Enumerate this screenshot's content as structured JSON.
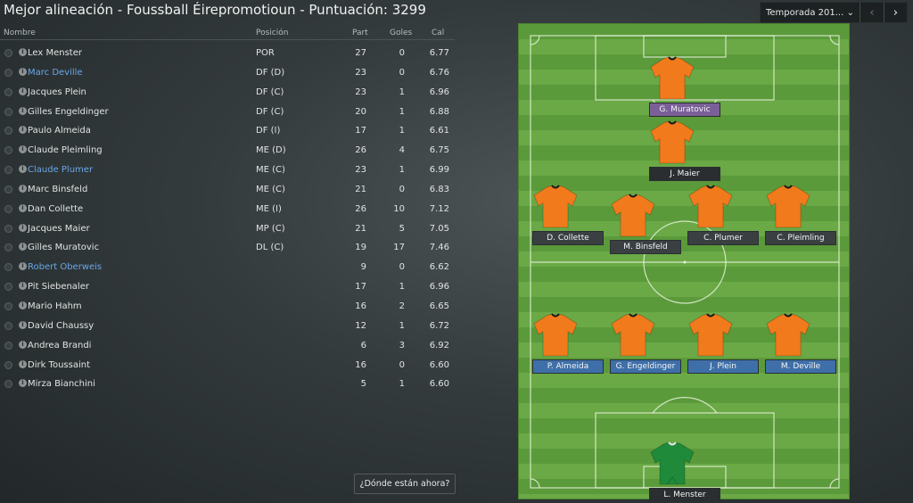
{
  "header": {
    "title": "Mejor alineación - Foussball Éirepromotioun - Puntuación: 3299",
    "season_label": "Temporada 201...",
    "prev_icon": "chevron-left-icon",
    "next_icon": "chevron-right-icon"
  },
  "table": {
    "columns": {
      "name": "Nombre",
      "position": "Posición",
      "apps": "Part",
      "goals": "Goles",
      "rating": "Cal"
    },
    "rows": [
      {
        "name": "Lex Menster",
        "position": "POR",
        "apps": "27",
        "goals": "0",
        "rating": "6.77",
        "link": false
      },
      {
        "name": "Marc Deville",
        "position": "DF (D)",
        "apps": "23",
        "goals": "0",
        "rating": "6.76",
        "link": true
      },
      {
        "name": "Jacques Plein",
        "position": "DF (C)",
        "apps": "23",
        "goals": "1",
        "rating": "6.96",
        "link": false
      },
      {
        "name": "Gilles Engeldinger",
        "position": "DF (C)",
        "apps": "20",
        "goals": "1",
        "rating": "6.88",
        "link": false
      },
      {
        "name": "Paulo Almeida",
        "position": "DF (I)",
        "apps": "17",
        "goals": "1",
        "rating": "6.61",
        "link": false
      },
      {
        "name": "Claude Pleimling",
        "position": "ME (D)",
        "apps": "26",
        "goals": "4",
        "rating": "6.75",
        "link": false
      },
      {
        "name": "Claude Plumer",
        "position": "ME (C)",
        "apps": "23",
        "goals": "1",
        "rating": "6.99",
        "link": true
      },
      {
        "name": "Marc Binsfeld",
        "position": "ME (C)",
        "apps": "21",
        "goals": "0",
        "rating": "6.83",
        "link": false
      },
      {
        "name": "Dan Collette",
        "position": "ME (I)",
        "apps": "26",
        "goals": "10",
        "rating": "7.12",
        "link": false
      },
      {
        "name": "Jacques Maier",
        "position": "MP (C)",
        "apps": "21",
        "goals": "5",
        "rating": "7.05",
        "link": false
      },
      {
        "name": "Gilles Muratovic",
        "position": "DL (C)",
        "apps": "19",
        "goals": "17",
        "rating": "7.46",
        "link": false
      },
      {
        "name": "Robert Oberweis",
        "position": "",
        "apps": "9",
        "goals": "0",
        "rating": "6.62",
        "link": true
      },
      {
        "name": "Pit Siebenaler",
        "position": "",
        "apps": "17",
        "goals": "1",
        "rating": "6.96",
        "link": false
      },
      {
        "name": "Mario Hahm",
        "position": "",
        "apps": "16",
        "goals": "2",
        "rating": "6.65",
        "link": false
      },
      {
        "name": "David Chaussy",
        "position": "",
        "apps": "12",
        "goals": "1",
        "rating": "6.72",
        "link": false
      },
      {
        "name": "Andrea Brandi",
        "position": "",
        "apps": "6",
        "goals": "3",
        "rating": "6.92",
        "link": false
      },
      {
        "name": "Dirk Toussaint",
        "position": "",
        "apps": "16",
        "goals": "0",
        "rating": "6.60",
        "link": false
      },
      {
        "name": "Mirza Bianchini",
        "position": "",
        "apps": "5",
        "goals": "1",
        "rating": "6.60",
        "link": false
      }
    ]
  },
  "where_button": "¿Dónde están ahora?",
  "pitch": {
    "players": [
      {
        "label": "G. Muratovic",
        "style": "purple",
        "kit": "outfield"
      },
      {
        "label": "J. Maier",
        "style": "dark",
        "kit": "outfield"
      },
      {
        "label": "D. Collette",
        "style": "grey",
        "kit": "outfield"
      },
      {
        "label": "M. Binsfeld",
        "style": "grey",
        "kit": "outfield"
      },
      {
        "label": "C. Plumer",
        "style": "grey",
        "kit": "outfield"
      },
      {
        "label": "C. Pleimling",
        "style": "grey",
        "kit": "outfield"
      },
      {
        "label": "P. Almeida",
        "style": "blue",
        "kit": "outfield"
      },
      {
        "label": "G. Engeldinger",
        "style": "blue",
        "kit": "outfield"
      },
      {
        "label": "J. Plein",
        "style": "blue",
        "kit": "outfield"
      },
      {
        "label": "M. Deville",
        "style": "blue",
        "kit": "outfield"
      },
      {
        "label": "L. Menster",
        "style": "dark",
        "kit": "goalkeeper"
      }
    ]
  },
  "colors": {
    "outfield_kit": "#f07a1c",
    "goalkeeper_kit": "#1f8a3a",
    "link": "#6aa7e6"
  }
}
